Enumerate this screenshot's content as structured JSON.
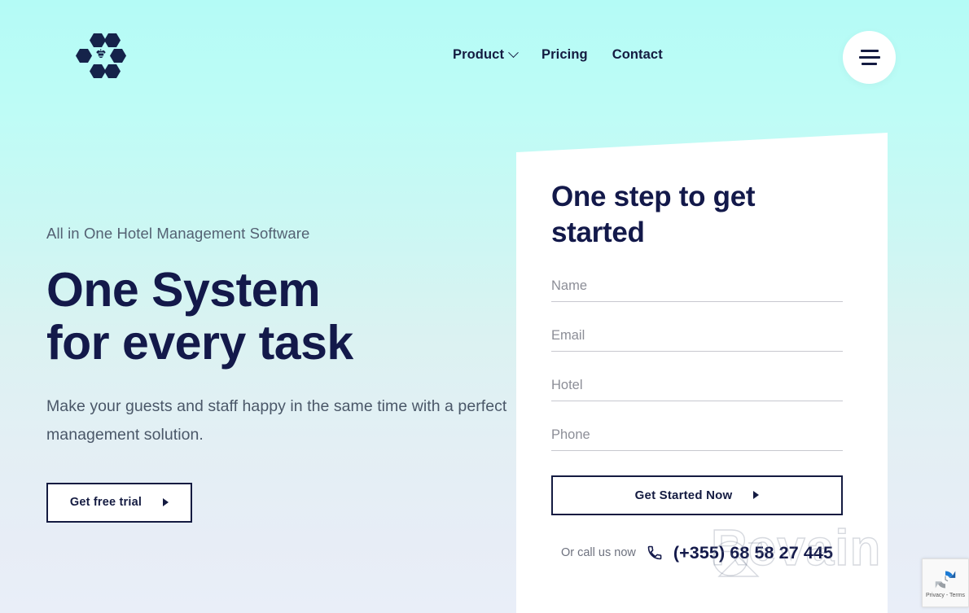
{
  "header": {
    "logo_alt": "honeycomb-bee-logo",
    "nav": [
      {
        "label": "Product",
        "has_dropdown": true
      },
      {
        "label": "Pricing",
        "has_dropdown": false
      },
      {
        "label": "Contact",
        "has_dropdown": false
      }
    ],
    "menu_icon": "hamburger-icon"
  },
  "hero": {
    "eyebrow": "All in One Hotel Management Software",
    "headline_line1": "One System",
    "headline_line2": "for every task",
    "subtext": "Make your guests and staff happy in the same time with a perfect management solution.",
    "cta_label": "Get free trial",
    "cta_arrow": "play-triangle-icon"
  },
  "form": {
    "title": "One step to get started",
    "fields": [
      {
        "name": "name",
        "placeholder": "Name",
        "value": ""
      },
      {
        "name": "email",
        "placeholder": "Email",
        "value": ""
      },
      {
        "name": "hotel",
        "placeholder": "Hotel",
        "value": ""
      },
      {
        "name": "phone",
        "placeholder": "Phone",
        "value": ""
      }
    ],
    "submit_label": "Get Started Now",
    "submit_arrow": "play-triangle-icon",
    "call_label": "Or call us now",
    "phone_icon": "phone-handset-icon",
    "phone_number": "(+355) 68 58 27 445"
  },
  "watermark": {
    "text": "Revain"
  },
  "recaptcha": {
    "icon": "recaptcha-icon",
    "text": "Privacy - Terms"
  },
  "colors": {
    "bg_top": "#b4fbf6",
    "bg_bottom": "#e9eef8",
    "ink": "#13194a",
    "muted": "#546173",
    "card_bg": "#ffffff",
    "field_rule": "#c7c8cf"
  }
}
